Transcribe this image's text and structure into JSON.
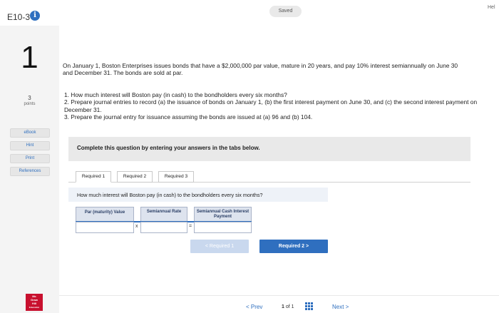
{
  "header": {
    "assignment_id": "E10-3",
    "info_icon": "info-icon",
    "saved_label": "Saved",
    "help_label": "Hel"
  },
  "sidebar": {
    "question_number": "1",
    "points_value": "3",
    "points_label": "points",
    "buttons": [
      "eBook",
      "Hint",
      "Print",
      "References"
    ]
  },
  "question": {
    "intro": "On January 1, Boston Enterprises issues bonds that have a $2,000,000 par value, mature in 20 years, and pay 10% interest semiannually on June 30 and December 31. The bonds are sold at par.",
    "task1": "1. How much interest will Boston pay (in cash) to the bondholders every six months?",
    "task2": "2. Prepare journal entries to record (a) the issuance of bonds on January 1, (b) the first interest payment on June 30, and (c) the second interest payment on December 31.",
    "task3": "3. Prepare the journal entry for issuance assuming the bonds are issued at (a) 96 and (b) 104."
  },
  "instructions": "Complete this question by entering your answers in the tabs below.",
  "tabs": [
    "Required 1",
    "Required 2",
    "Required 3"
  ],
  "active_tab": "Required 1",
  "prompt": "How much interest will Boston pay (in cash) to the bondholders every six months?",
  "grid": {
    "headers": [
      "Par (maturity) Value",
      "Semiannual Rate",
      "Semiannual Cash Interest Payment"
    ],
    "operators": [
      "x",
      "="
    ],
    "values": [
      "",
      "",
      ""
    ]
  },
  "nav_buttons": {
    "prev": "< Required 1",
    "next": "Required 2  >"
  },
  "footer": {
    "prev": "< Prev",
    "page_current": "1",
    "page_of": "of",
    "page_total": "1",
    "grid_icon": "grid-icon",
    "next": "Next >"
  },
  "colors": {
    "accent": "#2f6fbf",
    "brand_red": "#c8102e"
  },
  "logo_text": [
    "Mc",
    "Graw",
    "Hill",
    "Education"
  ]
}
